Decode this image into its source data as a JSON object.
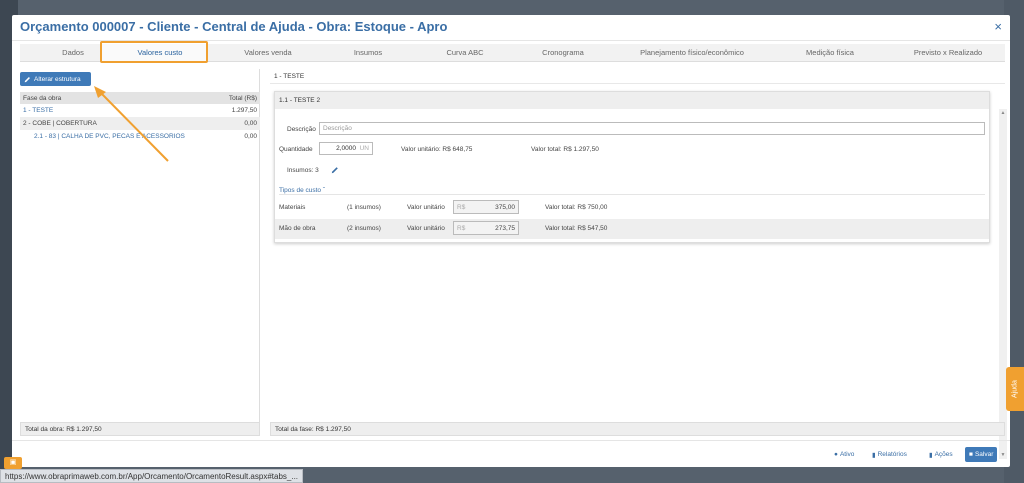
{
  "window": {
    "title": "Orçamento 000007 - Cliente - Central de Ajuda - Obra: Estoque - Apro",
    "close_glyph": "×"
  },
  "tabs": [
    {
      "label": "Dados"
    },
    {
      "label": "Valores custo",
      "active": true
    },
    {
      "label": "Valores venda"
    },
    {
      "label": "Insumos"
    },
    {
      "label": "Curva ABC"
    },
    {
      "label": "Cronograma"
    },
    {
      "label": "Planejamento físico/econômico"
    },
    {
      "label": "Medição física"
    },
    {
      "label": "Previsto x Realizado"
    }
  ],
  "left": {
    "button_label": "Alterar estrutura",
    "table_header": {
      "col1": "Fase da obra",
      "col2": "Total (R$)"
    },
    "rows": [
      {
        "label": "1 - TESTE",
        "value": "1.297,50"
      },
      {
        "label": "2 - COBE | COBERTURA",
        "value": "0,00"
      },
      {
        "label": "2.1 - 83 | CALHA DE PVC, PECAS E ACESSORIOS",
        "value": "0,00"
      }
    ],
    "footer": "Total da obra: R$ 1.297,50"
  },
  "right": {
    "header": "1 - TESTE",
    "card_title": "1.1 - TESTE 2",
    "descricao_label": "Descrição",
    "descricao_placeholder": "Descrição",
    "quantidade_label": "Quantidade",
    "quantidade_value": "2,0000",
    "quantidade_unit": "UN",
    "valor_unitario": "Valor unitário: R$ 648,75",
    "valor_total": "Valor total: R$ 1.297,50",
    "insumos_label": "Insumos: 3",
    "tipos_custo_label": "Tipos de custo",
    "cost_types": [
      {
        "name": "Materiais",
        "insumos": "(1 insumos)",
        "unit_label": "Valor unitário",
        "currency": "R$",
        "unit_value": "375,00",
        "total": "Valor total: R$ 750,00"
      },
      {
        "name": "Mão de obra",
        "insumos": "(2 insumos)",
        "unit_label": "Valor unitário",
        "currency": "R$",
        "unit_value": "273,75",
        "total": "Valor total: R$ 547,50"
      }
    ],
    "footer": "Total da fase: R$ 1.297,50"
  },
  "bottom": {
    "ativo": "Ativo",
    "relatorios": "Relatórios",
    "acoes": "Ações",
    "salvar": "Salvar"
  },
  "help_tab": "Ajuda",
  "status_url": "https://www.obraprimaweb.com.br/App/Orcamento/OrcamentoResult.aspx#tabs_...",
  "colors": {
    "accent": "#3a6ea5",
    "highlight": "#f0a030",
    "primary_button": "#3f7ab8"
  }
}
